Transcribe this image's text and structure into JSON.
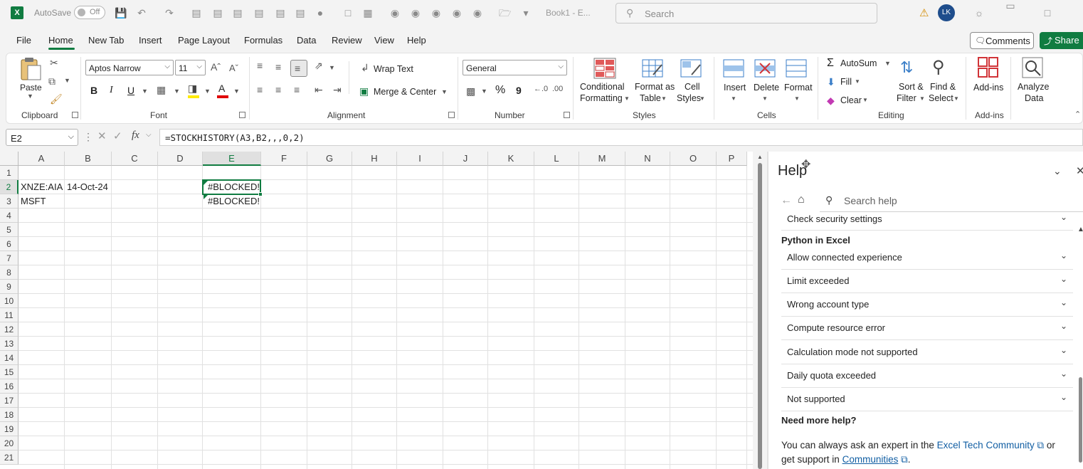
{
  "titlebar": {
    "autosave_label": "AutoSave",
    "autosave_state": "Off",
    "doc_title": "Book1 - E...",
    "search_placeholder": "Search",
    "user_initials": "LK"
  },
  "menu": {
    "tabs": [
      "File",
      "Home",
      "New Tab",
      "Insert",
      "Page Layout",
      "Formulas",
      "Data",
      "Review",
      "View",
      "Help"
    ],
    "active": "Home",
    "comments": "Comments",
    "share": "Share"
  },
  "ribbon": {
    "clipboard": {
      "paste": "Paste",
      "label": "Clipboard"
    },
    "font": {
      "family": "Aptos Narrow",
      "size": "11",
      "label": "Font",
      "bold": "B",
      "italic": "I",
      "underline": "U"
    },
    "alignment": {
      "wrap_text": "Wrap Text",
      "merge_center": "Merge & Center",
      "label": "Alignment"
    },
    "number": {
      "format": "General",
      "label": "Number",
      "percent": "%",
      "comma": "9"
    },
    "styles": {
      "conditional_1": "Conditional",
      "conditional_2": "Formatting",
      "format_as_1": "Format as",
      "format_as_2": "Table",
      "cell_styles_1": "Cell",
      "cell_styles_2": "Styles",
      "label": "Styles"
    },
    "cells": {
      "insert": "Insert",
      "delete": "Delete",
      "format": "Format",
      "label": "Cells"
    },
    "editing": {
      "autosum": "AutoSum",
      "fill": "Fill",
      "clear": "Clear",
      "sort_1": "Sort &",
      "sort_2": "Filter",
      "find_1": "Find &",
      "find_2": "Select",
      "label": "Editing"
    },
    "addins": {
      "addins": "Add-ins",
      "label": "Add-ins"
    },
    "analyze": {
      "line1": "Analyze",
      "line2": "Data"
    }
  },
  "formula_bar": {
    "name_box": "E2",
    "fx": "fx",
    "formula": "=STOCKHISTORY(A3,B2,,,0,2)"
  },
  "grid": {
    "columns": [
      "A",
      "B",
      "C",
      "D",
      "E",
      "F",
      "G",
      "H",
      "I",
      "J",
      "K",
      "L",
      "M",
      "N",
      "O",
      "P"
    ],
    "rows": [
      "1",
      "2",
      "3",
      "4",
      "5",
      "6",
      "7",
      "8",
      "9",
      "10",
      "11",
      "12",
      "13",
      "14",
      "15",
      "16",
      "17",
      "18",
      "19",
      "20",
      "21"
    ],
    "selected_cell": "E2",
    "cells": {
      "A2": "XNZE:AIA",
      "B2": "14-Oct-24",
      "E2": "#BLOCKED!",
      "A3": "MSFT",
      "E3": "#BLOCKED!"
    }
  },
  "help": {
    "title": "Help",
    "search_placeholder": "Search help",
    "items_top": [
      "Check security settings"
    ],
    "section": "Python in Excel",
    "items": [
      "Allow connected experience",
      "Limit exceeded",
      "Wrong account type",
      "Compute resource error",
      "Calculation mode not supported",
      "Daily quota exceeded",
      "Not supported"
    ],
    "need_more": "Need more help?",
    "text_1": "You can always ask an expert in the",
    "link_1": "Excel Tech Community",
    "text_2": "or",
    "text_3": "get support in",
    "link_2": "Communities",
    "text_4": "."
  },
  "colors": {
    "accent": "#107c41",
    "link": "#115ea3",
    "avatar": "#1e4d8c"
  }
}
